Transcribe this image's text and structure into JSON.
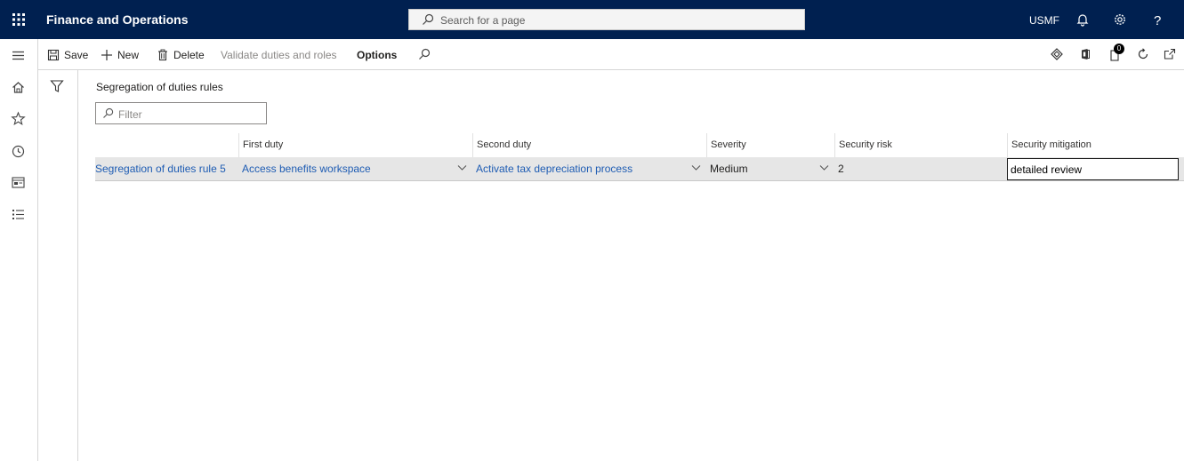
{
  "header": {
    "app_title": "Finance and Operations",
    "search_placeholder": "Search for a page",
    "company": "USMF",
    "colors": {
      "nav_bg": "#002050",
      "link": "#1e5cb3",
      "selected_row": "#e6e6e6"
    }
  },
  "actions": {
    "save": "Save",
    "new": "New",
    "delete": "Delete",
    "validate": "Validate duties and roles",
    "options": "Options",
    "notification_count": "0"
  },
  "page": {
    "caption": "Segregation of duties rules",
    "filter_placeholder": "Filter"
  },
  "grid": {
    "columns": [
      "",
      "First duty",
      "Second duty",
      "Severity",
      "Security risk",
      "Security mitigation"
    ],
    "rows": [
      {
        "name": "Segregation of duties rule 5",
        "first_duty": "Access benefits workspace",
        "second_duty": "Activate tax depreciation process",
        "severity": "Medium",
        "security_risk": "2",
        "security_mitigation": "detailed review"
      }
    ]
  }
}
